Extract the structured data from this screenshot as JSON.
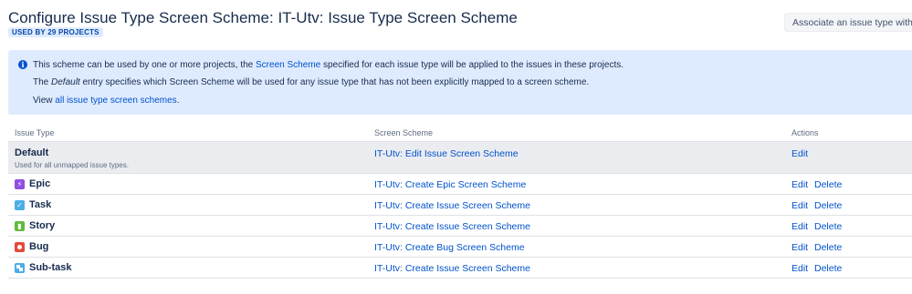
{
  "header": {
    "title": "Configure Issue Type Screen Scheme: IT-Utv: Issue Type Screen Scheme",
    "used_by": "USED BY 29 PROJECTS",
    "associate_button": "Associate an issue type with a screen scheme"
  },
  "info": {
    "line1_pre": "This scheme can be used by one or more projects, the ",
    "line1_link": "Screen Scheme",
    "line1_post": " specified for each issue type will be applied to the issues in these projects.",
    "line2_pre": "The ",
    "line2_em": "Default",
    "line2_post": " entry specifies which Screen Scheme will be used for any issue type that has not been explicitly mapped to a screen scheme.",
    "line3_pre": "View ",
    "line3_link": "all issue type screen schemes",
    "line3_post": "."
  },
  "table": {
    "headers": {
      "issue_type": "Issue Type",
      "screen_scheme": "Screen Scheme",
      "actions": "Actions"
    },
    "default_row": {
      "name": "Default",
      "description": "Used for all unmapped issue types.",
      "scheme": "IT-Utv: Edit Issue Screen Scheme",
      "edit": "Edit"
    },
    "rows": [
      {
        "name": "Epic",
        "icon": "epic-icon",
        "scheme": "IT-Utv: Create Epic Screen Scheme",
        "edit": "Edit",
        "delete": "Delete"
      },
      {
        "name": "Task",
        "icon": "task-icon",
        "scheme": "IT-Utv: Create Issue Screen Scheme",
        "edit": "Edit",
        "delete": "Delete"
      },
      {
        "name": "Story",
        "icon": "story-icon",
        "scheme": "IT-Utv: Create Issue Screen Scheme",
        "edit": "Edit",
        "delete": "Delete"
      },
      {
        "name": "Bug",
        "icon": "bug-icon",
        "scheme": "IT-Utv: Create Bug Screen Scheme",
        "edit": "Edit",
        "delete": "Delete"
      },
      {
        "name": "Sub-task",
        "icon": "subtask-icon",
        "scheme": "IT-Utv: Create Issue Screen Scheme",
        "edit": "Edit",
        "delete": "Delete"
      }
    ]
  },
  "colors": {
    "link": "#0052cc",
    "info_bg": "#deebff",
    "default_row_bg": "#ebecf0",
    "epic": "#904ee2",
    "task": "#4bade8",
    "story": "#63ba3c",
    "bug": "#e5493a"
  }
}
